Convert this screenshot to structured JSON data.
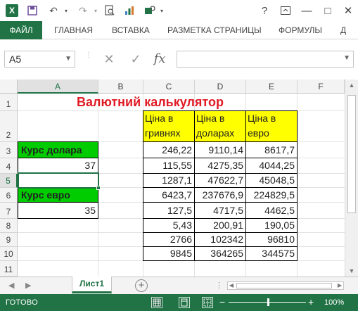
{
  "window": {
    "app_icon": "X",
    "title_icons": [
      "excel-logo",
      "save-icon",
      "undo-icon",
      "redo-icon",
      "print-preview-icon",
      "chart-icon",
      "settings-icon"
    ]
  },
  "window_controls": {
    "help": "?",
    "minimize": "—",
    "maximize": "□",
    "close": "✕"
  },
  "ribbon": {
    "tabs": [
      "ФАЙЛ",
      "ГЛАВНАЯ",
      "ВСТАВКА",
      "РАЗМЕТКА СТРАНИЦЫ",
      "ФОРМУЛЫ",
      "Д"
    ]
  },
  "formula_bar": {
    "name_box": "A5",
    "formula": ""
  },
  "columns": [
    "A",
    "B",
    "C",
    "D",
    "E",
    "F"
  ],
  "rows": [
    "1",
    "2",
    "3",
    "4",
    "5",
    "6",
    "7",
    "8",
    "9",
    "10",
    "11"
  ],
  "sheet": {
    "title": "Валютний калькулятор",
    "headers": {
      "hrn": [
        "Ціна в",
        "гривнях"
      ],
      "usd": [
        "Ціна в",
        "доларах"
      ],
      "eur": [
        "Ціна в",
        "евро"
      ]
    },
    "labels": {
      "usd_rate": "Курс долара",
      "eur_rate": "Курс евро"
    },
    "rates": {
      "usd": "37",
      "eur": "35"
    },
    "table": [
      [
        "246,22",
        "9110,14",
        "8617,7"
      ],
      [
        "115,55",
        "4275,35",
        "4044,25"
      ],
      [
        "1287,1",
        "47622,7",
        "45048,5"
      ],
      [
        "6423,7",
        "237676,9",
        "224829,5"
      ],
      [
        "127,5",
        "4717,5",
        "4462,5"
      ],
      [
        "5,43",
        "200,91",
        "190,05"
      ],
      [
        "2766",
        "102342",
        "96810"
      ],
      [
        "9845",
        "364265",
        "344575"
      ]
    ]
  },
  "sheet_tabs": {
    "active": "Лист1",
    "add": "+"
  },
  "status": {
    "ready": "ГОТОВО",
    "zoom": "100%",
    "zoom_minus": "−",
    "zoom_plus": "+"
  },
  "colors": {
    "excel_green": "#217346",
    "yellow": "#ffff00",
    "green_fill": "#00cc00",
    "title_red": "#e01b24"
  }
}
